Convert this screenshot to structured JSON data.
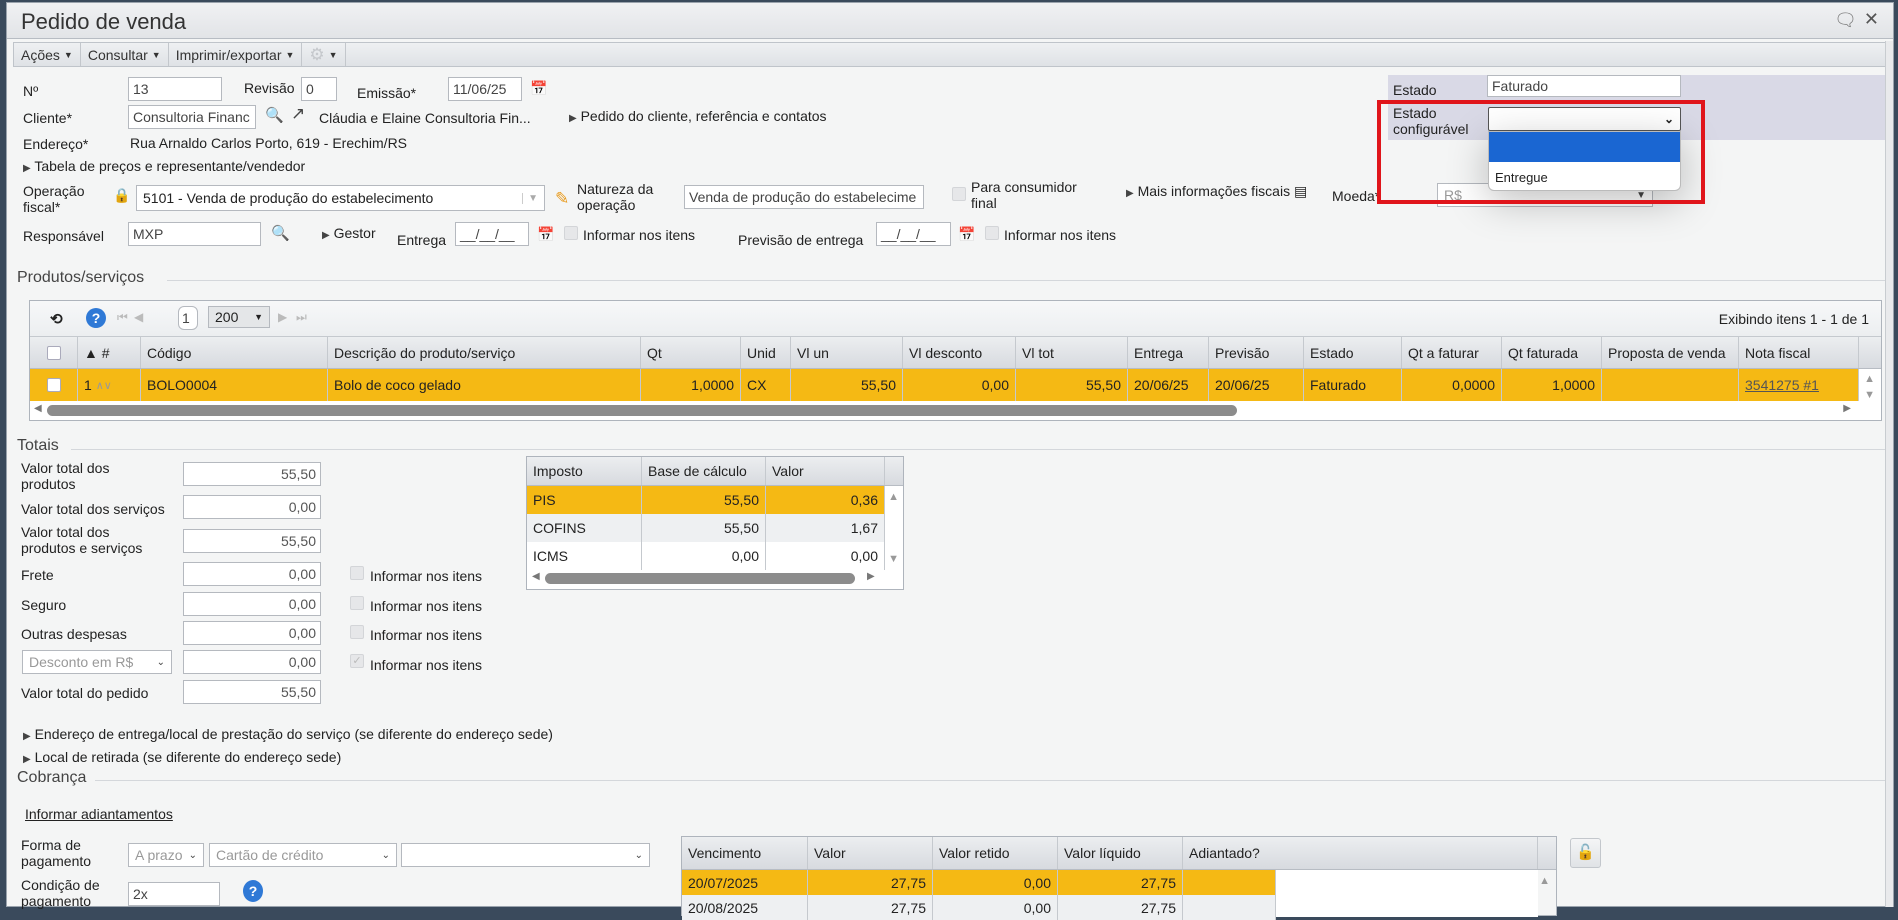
{
  "window": {
    "title": "Pedido de venda"
  },
  "toolbar": {
    "actions": "Ações",
    "consult": "Consultar",
    "print": "Imprimir/exportar"
  },
  "header": {
    "numero_label": "Nº",
    "numero": "13",
    "revisao_label": "Revisão",
    "revisao": "0",
    "emissao_label": "Emissão*",
    "emissao": "11/06/25",
    "cliente_label": "Cliente*",
    "cliente": "Consultoria Financ",
    "cliente_nome": "Cláudia e Elaine Consultoria Fin...",
    "pedido_cliente_link": "Pedido do cliente, referência e contatos",
    "endereco_label": "Endereço*",
    "endereco": "Rua Arnaldo Carlos Porto, 619 - Erechim/RS",
    "tabela_precos_link": "Tabela de preços e representante/vendedor",
    "operacao_label_1": "Operação",
    "operacao_label_2": "fiscal*",
    "operacao": "5101 - Venda de produção do estabelecimento",
    "natureza_label_1": "Natureza da",
    "natureza_label_2": "operação",
    "natureza": "Venda de produção do estabelecime",
    "consumidor_label_1": "Para consumidor",
    "consumidor_label_2": "final",
    "mais_info_link": "Mais informações fiscais",
    "moeda_label": "Moeda*",
    "moeda": "R$",
    "responsavel_label": "Responsável",
    "responsavel": "MXP",
    "gestor_link": "Gestor",
    "entrega_label": "Entrega",
    "entrega": "__/__/__",
    "informar_itens": "Informar nos itens",
    "previsao_label": "Previsão de entrega",
    "previsao": "__/__/__"
  },
  "status": {
    "estado_label": "Estado",
    "estado": "Faturado",
    "estado_config_label_1": "Estado",
    "estado_config_label_2": "configurável",
    "estado_config": "",
    "options": [
      "",
      "Entregue"
    ],
    "highlight_color": "#e0151b"
  },
  "products": {
    "section_title": "Produtos/serviços",
    "page": "1",
    "page_size": "200",
    "showing": "Exibindo itens 1 - 1 de 1",
    "columns": [
      "▲ #",
      "Código",
      "Descrição do produto/serviço",
      "Qt",
      "Unid",
      "Vl un",
      "Vl desconto",
      "Vl tot",
      "Entrega",
      "Previsão",
      "Estado",
      "Qt a faturar",
      "Qt faturada",
      "Proposta de venda",
      "Nota fiscal"
    ],
    "rows": [
      {
        "num": "1",
        "codigo": "BOLO0004",
        "descricao": "Bolo de coco gelado",
        "qt": "1,0000",
        "unid": "CX",
        "vl_un": "55,50",
        "vl_desc": "0,00",
        "vl_tot": "55,50",
        "entrega": "20/06/25",
        "previsao": "20/06/25",
        "estado": "Faturado",
        "qt_faturar": "0,0000",
        "qt_faturada": "1,0000",
        "proposta": "",
        "nota": "3541275 #1"
      }
    ]
  },
  "totals": {
    "section_title": "Totais",
    "produtos_1": "Valor total dos",
    "produtos_2": "produtos",
    "produtos": "55,50",
    "servicos_label": "Valor total dos serviços",
    "servicos": "0,00",
    "prod_serv_1": "Valor total dos",
    "prod_serv_2": "produtos e serviços",
    "prod_serv": "55,50",
    "frete_label": "Frete",
    "frete": "0,00",
    "seguro_label": "Seguro",
    "seguro": "0,00",
    "outras_label": "Outras despesas",
    "outras": "0,00",
    "desconto_tipo": "Desconto em R$",
    "desconto": "0,00",
    "pedido_label": "Valor total do pedido",
    "pedido": "55,50",
    "informar_itens": "Informar nos itens"
  },
  "taxes": {
    "columns": [
      "Imposto",
      "Base de cálculo",
      "Valor"
    ],
    "rows": [
      {
        "imposto": "PIS",
        "base": "55,50",
        "valor": "0,36"
      },
      {
        "imposto": "COFINS",
        "base": "55,50",
        "valor": "1,67"
      },
      {
        "imposto": "ICMS",
        "base": "0,00",
        "valor": "0,00"
      }
    ]
  },
  "links": {
    "endereco_entrega": "Endereço de entrega/local de prestação do serviço (se diferente do endereço sede)",
    "local_retirada": "Local de retirada (se diferente do endereço sede)"
  },
  "billing": {
    "section_title": "Cobrança",
    "adiantamentos_link": "Informar adiantamentos",
    "forma_1": "Forma de",
    "forma_2": "pagamento",
    "prazo": "A prazo",
    "meio": "Cartão de crédito",
    "extra": "",
    "condicao_1": "Condição de",
    "condicao_2": "pagamento",
    "condicao": "2x",
    "columns": [
      "Vencimento",
      "Valor",
      "Valor retido",
      "Valor líquido",
      "Adiantado?"
    ],
    "rows": [
      {
        "venc": "20/07/2025",
        "valor": "27,75",
        "retido": "0,00",
        "liquido": "27,75",
        "adiantado": ""
      },
      {
        "venc": "20/08/2025",
        "valor": "27,75",
        "retido": "0,00",
        "liquido": "27,75",
        "adiantado": ""
      }
    ]
  }
}
